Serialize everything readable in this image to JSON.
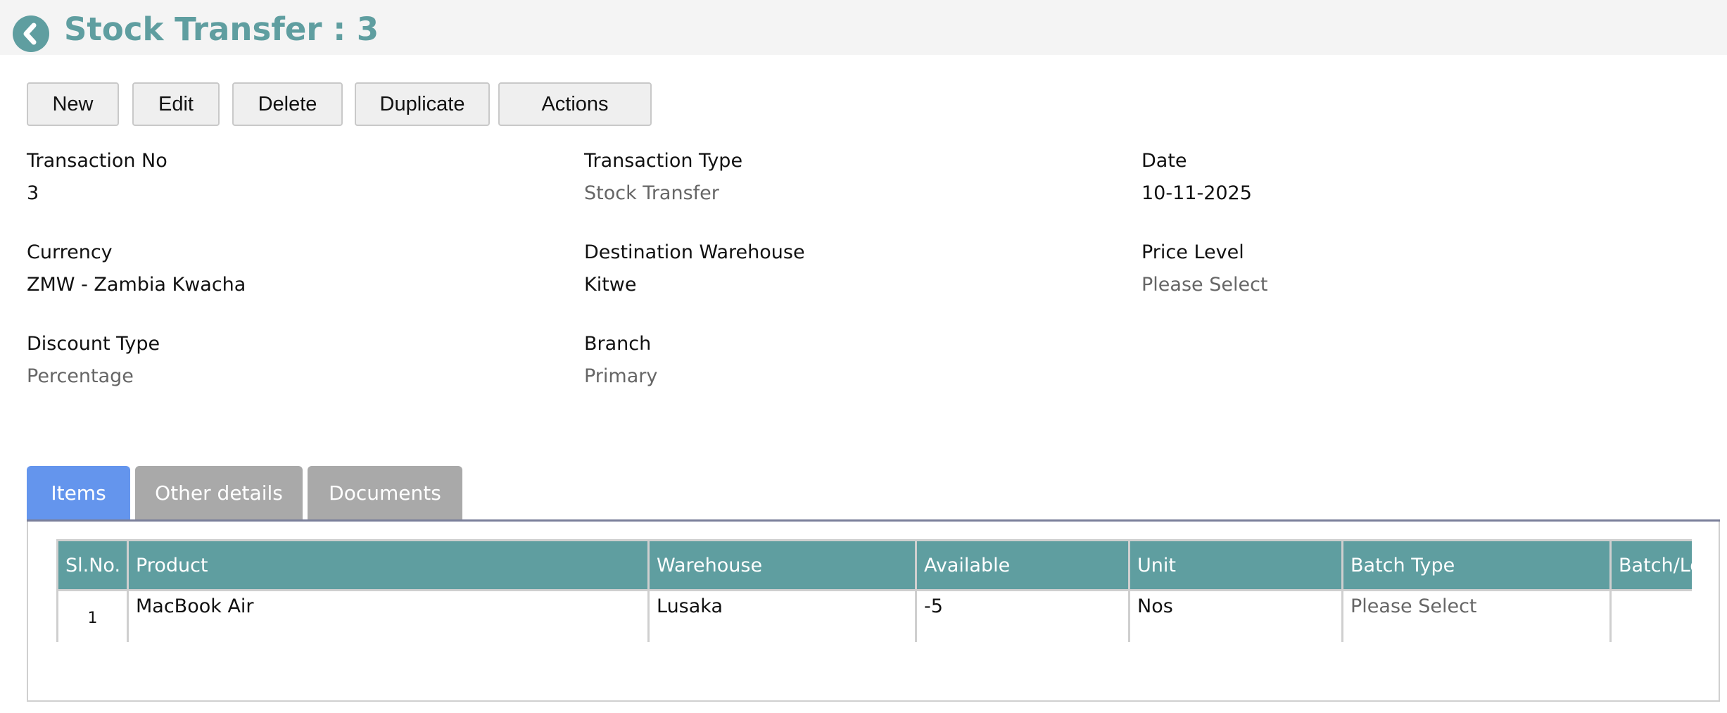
{
  "header": {
    "title": "Stock Transfer : 3"
  },
  "toolbar": {
    "new": "New",
    "edit": "Edit",
    "delete": "Delete",
    "duplicate": "Duplicate",
    "actions": "Actions"
  },
  "fields": {
    "transaction_no": {
      "label": "Transaction No",
      "value": "3"
    },
    "transaction_type": {
      "label": "Transaction Type",
      "value": "Stock Transfer"
    },
    "date": {
      "label": "Date",
      "value": "10-11-2025"
    },
    "currency": {
      "label": "Currency",
      "value": "ZMW - Zambia Kwacha"
    },
    "destination_warehouse": {
      "label": "Destination Warehouse",
      "value": "Kitwe"
    },
    "price_level": {
      "label": "Price Level",
      "value": "Please Select"
    },
    "discount_type": {
      "label": "Discount Type",
      "value": "Percentage"
    },
    "branch": {
      "label": "Branch",
      "value": "Primary"
    }
  },
  "tabs": [
    {
      "label": "Items",
      "active": true
    },
    {
      "label": "Other details",
      "active": false
    },
    {
      "label": "Documents",
      "active": false
    }
  ],
  "items_table": {
    "columns": [
      "Sl.No.",
      "Product",
      "Warehouse",
      "Available",
      "Unit",
      "Batch Type",
      "Batch/Lot"
    ],
    "rows": [
      [
        "1",
        "MacBook Air",
        "Lusaka",
        "-5",
        "Nos",
        "Please Select",
        ""
      ]
    ]
  },
  "colors": {
    "accent": "#5f9ea0",
    "active_tab": "#6495ed",
    "inactive_tab": "#a9a9a9",
    "header_bg": "#f4f4f4"
  },
  "icons": {
    "back": "chevron-left-circle-icon"
  }
}
